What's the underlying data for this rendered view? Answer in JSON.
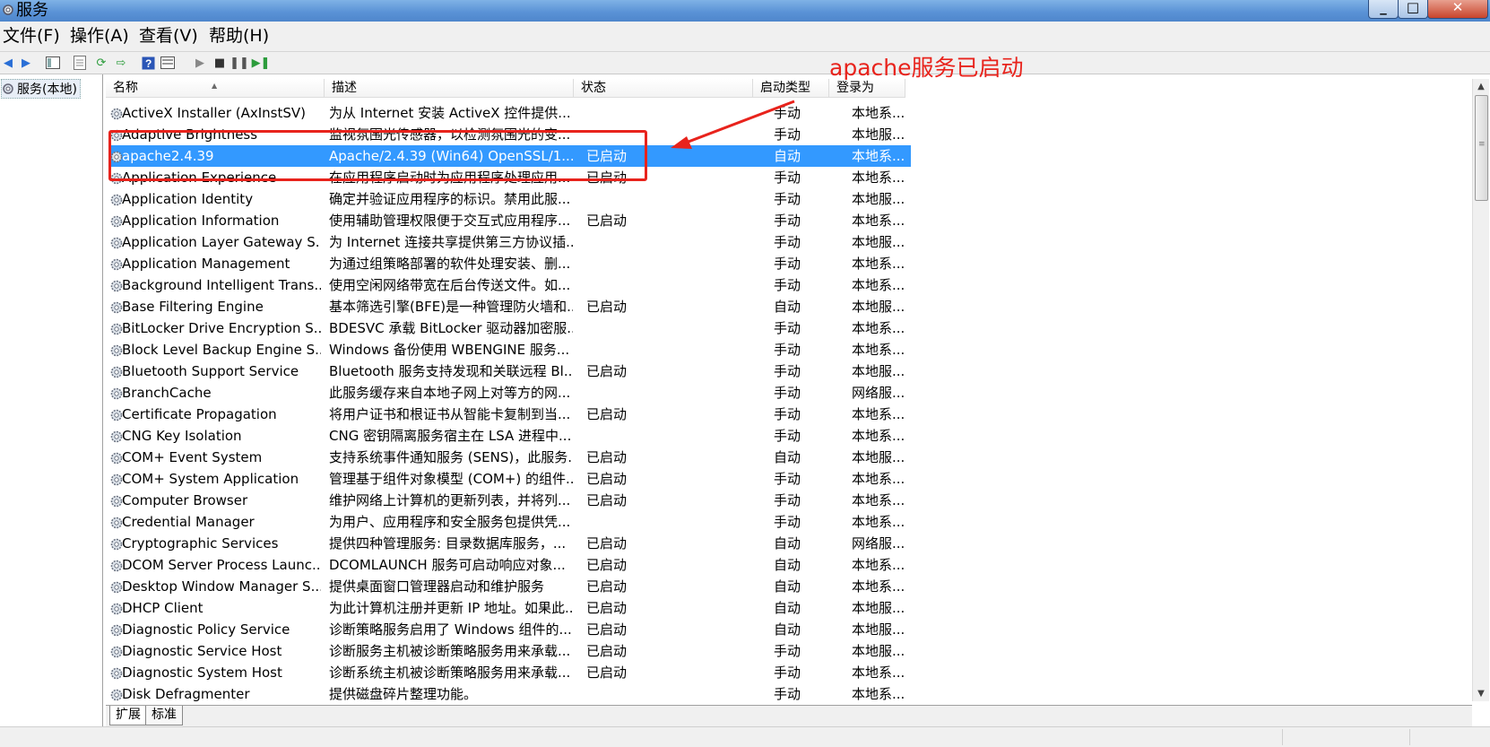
{
  "window": {
    "title": "服务"
  },
  "menu": [
    "文件(F)",
    "操作(A)",
    "查看(V)",
    "帮助(H)"
  ],
  "toolbar": {
    "icons": [
      "back-arrow-icon",
      "forward-arrow-icon",
      "show-hide-tree-icon",
      "properties-icon",
      "refresh-icon",
      "export-list-icon",
      "help-icon",
      "mmc-view-icon",
      "start-service-icon",
      "stop-service-icon",
      "pause-service-icon",
      "restart-service-icon"
    ]
  },
  "tree": {
    "node_label": "服务(本地)"
  },
  "columns": {
    "name": "名称",
    "description": "描述",
    "status": "状态",
    "startup_type": "启动类型",
    "logon_as": "登录为"
  },
  "services": [
    {
      "name": "ActiveX Installer (AxInstSV)",
      "desc": "为从 Internet 安装 ActiveX 控件提供...",
      "status": "",
      "startup": "手动",
      "logon": "本地系..."
    },
    {
      "name": "Adaptive Brightness",
      "desc": "监视氛围光传感器，以检测氛围光的变...",
      "status": "",
      "startup": "手动",
      "logon": "本地服..."
    },
    {
      "name": "apache2.4.39",
      "desc": "Apache/2.4.39 (Win64) OpenSSL/1....",
      "status": "已启动",
      "startup": "自动",
      "logon": "本地系...",
      "selected": true
    },
    {
      "name": "Application Experience",
      "desc": "在应用程序启动时为应用程序处理应用...",
      "status": "已启动",
      "startup": "手动",
      "logon": "本地系..."
    },
    {
      "name": "Application Identity",
      "desc": "确定并验证应用程序的标识。禁用此服...",
      "status": "",
      "startup": "手动",
      "logon": "本地服..."
    },
    {
      "name": "Application Information",
      "desc": "使用辅助管理权限便于交互式应用程序...",
      "status": "已启动",
      "startup": "手动",
      "logon": "本地系..."
    },
    {
      "name": "Application Layer Gateway S...",
      "desc": "为 Internet 连接共享提供第三方协议插...",
      "status": "",
      "startup": "手动",
      "logon": "本地服..."
    },
    {
      "name": "Application Management",
      "desc": "为通过组策略部署的软件处理安装、删...",
      "status": "",
      "startup": "手动",
      "logon": "本地系..."
    },
    {
      "name": "Background Intelligent Trans...",
      "desc": "使用空闲网络带宽在后台传送文件。如...",
      "status": "",
      "startup": "手动",
      "logon": "本地系..."
    },
    {
      "name": "Base Filtering Engine",
      "desc": "基本筛选引擎(BFE)是一种管理防火墙和...",
      "status": "已启动",
      "startup": "自动",
      "logon": "本地服..."
    },
    {
      "name": "BitLocker Drive Encryption S...",
      "desc": "BDESVC 承载 BitLocker 驱动器加密服...",
      "status": "",
      "startup": "手动",
      "logon": "本地系..."
    },
    {
      "name": "Block Level Backup Engine S...",
      "desc": "Windows 备份使用 WBENGINE 服务...",
      "status": "",
      "startup": "手动",
      "logon": "本地系..."
    },
    {
      "name": "Bluetooth Support Service",
      "desc": "Bluetooth 服务支持发现和关联远程 Bl...",
      "status": "已启动",
      "startup": "手动",
      "logon": "本地服..."
    },
    {
      "name": "BranchCache",
      "desc": "此服务缓存来自本地子网上对等方的网...",
      "status": "",
      "startup": "手动",
      "logon": "网络服..."
    },
    {
      "name": "Certificate Propagation",
      "desc": "将用户证书和根证书从智能卡复制到当...",
      "status": "已启动",
      "startup": "手动",
      "logon": "本地系..."
    },
    {
      "name": "CNG Key Isolation",
      "desc": "CNG 密钥隔离服务宿主在 LSA 进程中...",
      "status": "",
      "startup": "手动",
      "logon": "本地系..."
    },
    {
      "name": "COM+ Event System",
      "desc": "支持系统事件通知服务 (SENS)，此服务...",
      "status": "已启动",
      "startup": "自动",
      "logon": "本地服..."
    },
    {
      "name": "COM+ System Application",
      "desc": "管理基于组件对象模型 (COM+) 的组件...",
      "status": "已启动",
      "startup": "手动",
      "logon": "本地系..."
    },
    {
      "name": "Computer Browser",
      "desc": "维护网络上计算机的更新列表，并将列...",
      "status": "已启动",
      "startup": "手动",
      "logon": "本地系..."
    },
    {
      "name": "Credential Manager",
      "desc": "为用户、应用程序和安全服务包提供凭...",
      "status": "",
      "startup": "手动",
      "logon": "本地系..."
    },
    {
      "name": "Cryptographic Services",
      "desc": "提供四种管理服务: 目录数据库服务，...",
      "status": "已启动",
      "startup": "自动",
      "logon": "网络服..."
    },
    {
      "name": "DCOM Server Process Launc...",
      "desc": "DCOMLAUNCH 服务可启动响应对象...",
      "status": "已启动",
      "startup": "自动",
      "logon": "本地系..."
    },
    {
      "name": "Desktop Window Manager S...",
      "desc": "提供桌面窗口管理器启动和维护服务",
      "status": "已启动",
      "startup": "自动",
      "logon": "本地系..."
    },
    {
      "name": "DHCP Client",
      "desc": "为此计算机注册并更新 IP 地址。如果此...",
      "status": "已启动",
      "startup": "自动",
      "logon": "本地服..."
    },
    {
      "name": "Diagnostic Policy Service",
      "desc": "诊断策略服务启用了 Windows 组件的...",
      "status": "已启动",
      "startup": "自动",
      "logon": "本地服..."
    },
    {
      "name": "Diagnostic Service Host",
      "desc": "诊断服务主机被诊断策略服务用来承载...",
      "status": "已启动",
      "startup": "手动",
      "logon": "本地服..."
    },
    {
      "name": "Diagnostic System Host",
      "desc": "诊断系统主机被诊断策略服务用来承载...",
      "status": "已启动",
      "startup": "手动",
      "logon": "本地系..."
    },
    {
      "name": "Disk Defragmenter",
      "desc": "提供磁盘碎片整理功能。",
      "status": "",
      "startup": "手动",
      "logon": "本地系..."
    }
  ],
  "tabs": [
    "扩展",
    "标准"
  ],
  "annotation": {
    "text": "apache服务已启动",
    "color": "#e8231c"
  },
  "colors": {
    "selection": "#3399ff",
    "annotation": "#e8231c",
    "titlebar": "#5b93d6"
  }
}
